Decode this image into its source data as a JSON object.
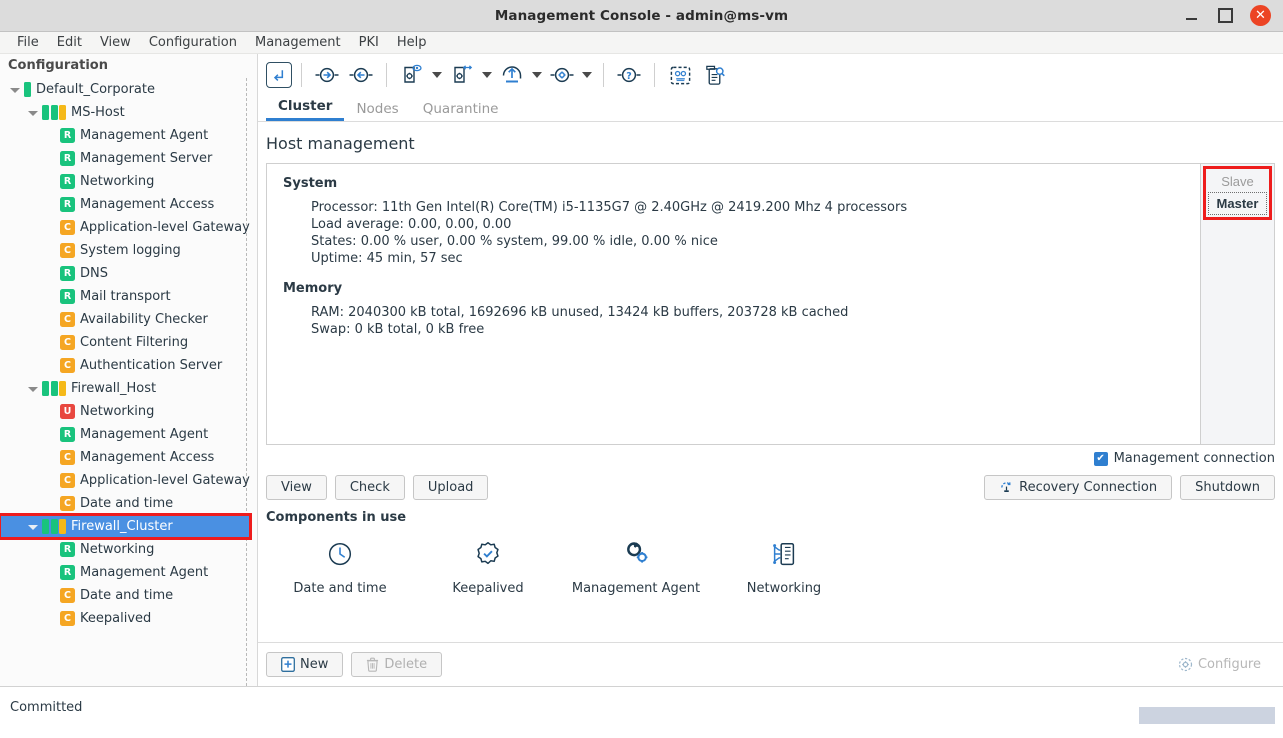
{
  "window": {
    "title": "Management Console - admin@ms-vm",
    "minimize_icon": "minimize-icon",
    "maximize_icon": "maximize-icon",
    "close_icon": "close-icon",
    "close_glyph": "✕"
  },
  "menubar": {
    "items": [
      "File",
      "Edit",
      "View",
      "Configuration",
      "Management",
      "PKI",
      "Help"
    ]
  },
  "sidebar": {
    "header": "Configuration",
    "tree": [
      {
        "label": "Default_Corporate",
        "depth": 0,
        "twisty": true,
        "icon": "bars",
        "bars": [
          "g"
        ]
      },
      {
        "label": "MS-Host",
        "depth": 1,
        "twisty": true,
        "icon": "bars",
        "bars": [
          "g",
          "g",
          "y"
        ]
      },
      {
        "label": "Management Agent",
        "depth": 2,
        "twisty": false,
        "icon": "badge",
        "badge": "R"
      },
      {
        "label": "Management Server",
        "depth": 2,
        "twisty": false,
        "icon": "badge",
        "badge": "R"
      },
      {
        "label": "Networking",
        "depth": 2,
        "twisty": false,
        "icon": "badge",
        "badge": "R"
      },
      {
        "label": "Management Access",
        "depth": 2,
        "twisty": false,
        "icon": "badge",
        "badge": "R"
      },
      {
        "label": "Application-level Gateway",
        "depth": 2,
        "twisty": false,
        "icon": "badge",
        "badge": "C"
      },
      {
        "label": "System logging",
        "depth": 2,
        "twisty": false,
        "icon": "badge",
        "badge": "C"
      },
      {
        "label": "DNS",
        "depth": 2,
        "twisty": false,
        "icon": "badge",
        "badge": "R"
      },
      {
        "label": "Mail transport",
        "depth": 2,
        "twisty": false,
        "icon": "badge",
        "badge": "R"
      },
      {
        "label": "Availability Checker",
        "depth": 2,
        "twisty": false,
        "icon": "badge",
        "badge": "C"
      },
      {
        "label": "Content Filtering",
        "depth": 2,
        "twisty": false,
        "icon": "badge",
        "badge": "C"
      },
      {
        "label": "Authentication Server",
        "depth": 2,
        "twisty": false,
        "icon": "badge",
        "badge": "C"
      },
      {
        "label": "Firewall_Host",
        "depth": 1,
        "twisty": true,
        "icon": "bars",
        "bars": [
          "g",
          "g",
          "y"
        ]
      },
      {
        "label": "Networking",
        "depth": 2,
        "twisty": false,
        "icon": "badge",
        "badge": "U"
      },
      {
        "label": "Management Agent",
        "depth": 2,
        "twisty": false,
        "icon": "badge",
        "badge": "R"
      },
      {
        "label": "Management Access",
        "depth": 2,
        "twisty": false,
        "icon": "badge",
        "badge": "C"
      },
      {
        "label": "Application-level Gateway",
        "depth": 2,
        "twisty": false,
        "icon": "badge",
        "badge": "C"
      },
      {
        "label": "Date and time",
        "depth": 2,
        "twisty": false,
        "icon": "badge",
        "badge": "C"
      },
      {
        "label": "Firewall_Cluster",
        "depth": 1,
        "twisty": true,
        "icon": "bars",
        "bars": [
          "g",
          "g",
          "y"
        ],
        "selected": true,
        "highlighted": true
      },
      {
        "label": "Networking",
        "depth": 2,
        "twisty": false,
        "icon": "badge",
        "badge": "R"
      },
      {
        "label": "Management Agent",
        "depth": 2,
        "twisty": false,
        "icon": "badge",
        "badge": "R"
      },
      {
        "label": "Date and time",
        "depth": 2,
        "twisty": false,
        "icon": "badge",
        "badge": "C"
      },
      {
        "label": "Keepalived",
        "depth": 2,
        "twisty": false,
        "icon": "badge",
        "badge": "C"
      }
    ]
  },
  "toolbar": {
    "items": [
      {
        "name": "go-up-icon",
        "caret": false
      },
      {
        "name": "sep"
      },
      {
        "name": "forward-icon",
        "caret": false
      },
      {
        "name": "back-icon",
        "caret": false
      },
      {
        "name": "sep"
      },
      {
        "name": "preview-config-icon",
        "caret": true
      },
      {
        "name": "transfer-config-icon",
        "caret": true
      },
      {
        "name": "upload-icon",
        "caret": true
      },
      {
        "name": "settings-icon",
        "caret": true
      },
      {
        "name": "sep"
      },
      {
        "name": "help-icon",
        "caret": false
      },
      {
        "name": "sep"
      },
      {
        "name": "monitor-icon",
        "caret": false
      },
      {
        "name": "log-inspect-icon",
        "caret": false
      }
    ]
  },
  "tabs": [
    {
      "label": "Cluster",
      "active": true
    },
    {
      "label": "Nodes",
      "active": false
    },
    {
      "label": "Quarantine",
      "active": false
    }
  ],
  "page": {
    "title": "Host management"
  },
  "system": {
    "heading": "System",
    "lines": [
      "Processor: 11th Gen Intel(R) Core(TM) i5-1135G7 @ 2.40GHz @ 2419.200 Mhz 4 processors",
      "Load average: 0.00, 0.00, 0.00",
      "States: 0.00 % user, 0.00 % system, 99.00 % idle, 0.00 % nice",
      "Uptime: 45 min, 57 sec"
    ]
  },
  "memory": {
    "heading": "Memory",
    "lines": [
      "RAM: 2040300 kB total, 1692696 kB unused, 13424 kB buffers, 203728 kB cached",
      "Swap: 0 kB total, 0 kB free"
    ]
  },
  "role_selector": {
    "slave_label": "Slave",
    "master_label": "Master",
    "highlight_color": "#ee1c1c"
  },
  "actions": {
    "view_label": "View",
    "check_label": "Check",
    "upload_label": "Upload",
    "recovery_label": "Recovery Connection",
    "shutdown_label": "Shutdown",
    "management_connection_label": "Management connection"
  },
  "components": {
    "heading": "Components in use",
    "items": [
      {
        "label": "Date and time",
        "icon": "clock-icon"
      },
      {
        "label": "Keepalived",
        "icon": "gear-check-icon"
      },
      {
        "label": "Management Agent",
        "icon": "gears-icon"
      },
      {
        "label": "Networking",
        "icon": "network-icon"
      }
    ]
  },
  "bottom": {
    "new_label": "New",
    "delete_label": "Delete",
    "configure_label": "Configure"
  },
  "statusbar": {
    "text": "Committed"
  }
}
